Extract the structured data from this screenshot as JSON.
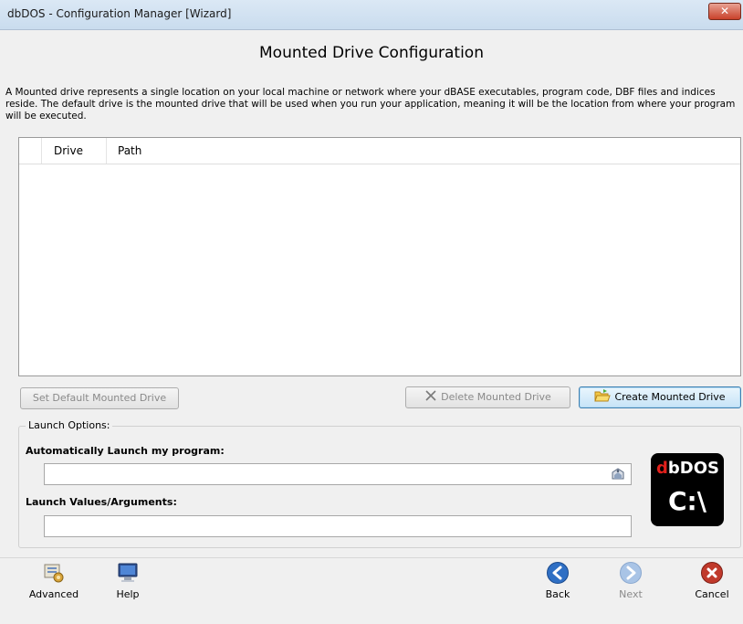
{
  "window": {
    "title": "dbDOS - Configuration Manager [Wizard]",
    "close_label": "✕"
  },
  "page": {
    "heading": "Mounted Drive Configuration",
    "description": "A Mounted drive represents a single location on your local machine or network where your dBASE executables, program code, DBF files and indices reside. The default drive is the mounted drive that will be used when you run your application, meaning it will be the location from where your program will be executed."
  },
  "grid": {
    "columns": [
      "Drive",
      "Path"
    ],
    "rows": []
  },
  "buttons": {
    "set_default": "Set Default Mounted Drive",
    "delete": "Delete Mounted Drive",
    "create": "Create Mounted Drive"
  },
  "launch": {
    "group_label": "Launch Options:",
    "auto_launch_label": "Automatically Launch my program:",
    "auto_launch_value": "",
    "args_label": "Launch Values/Arguments:",
    "args_value": ""
  },
  "logo": {
    "line1_d": "d",
    "line1_rest": "bDOS",
    "line2": "C:\\"
  },
  "footer": {
    "advanced": "Advanced",
    "help": "Help",
    "back": "Back",
    "next": "Next",
    "cancel": "Cancel"
  },
  "colors": {
    "accent_blue": "#2f6fc4",
    "cancel_red": "#c0392b",
    "logo_red": "#e0201b"
  }
}
